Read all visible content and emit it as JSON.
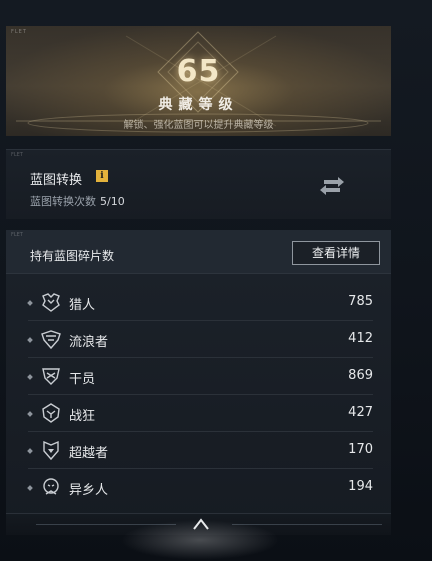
{
  "level_banner": {
    "corner_tag": "FLET",
    "level": "65",
    "title": "典藏等级",
    "subtitle": "解锁、强化蓝图可以提升典藏等级"
  },
  "convert_panel": {
    "corner_tag": "FLET",
    "title": "蓝图转换",
    "info_icon": "info-icon",
    "count_label": "蓝图转换次数",
    "count_value": "5/10",
    "action_icon": "swap-arrows-icon"
  },
  "fragments_panel": {
    "corner_tag": "FLET",
    "title": "持有蓝图碎片数",
    "detail_button": "查看详情",
    "items": [
      {
        "name": "猎人",
        "count": "785",
        "icon": "hunter-emblem-icon"
      },
      {
        "name": "流浪者",
        "count": "412",
        "icon": "wanderer-emblem-icon"
      },
      {
        "name": "干员",
        "count": "869",
        "icon": "operative-emblem-icon"
      },
      {
        "name": "战狂",
        "count": "427",
        "icon": "berserker-emblem-icon"
      },
      {
        "name": "超越者",
        "count": "170",
        "icon": "transcender-emblem-icon"
      },
      {
        "name": "异乡人",
        "count": "194",
        "icon": "stranger-emblem-icon"
      }
    ]
  },
  "bottom_bar": {
    "collapse_icon": "chevron-up-icon"
  },
  "colors": {
    "accent_gold": "#e3b23c",
    "panel_bg": "#1b2129",
    "text_primary": "#e6e8ea",
    "text_secondary": "#9aa2ab"
  }
}
